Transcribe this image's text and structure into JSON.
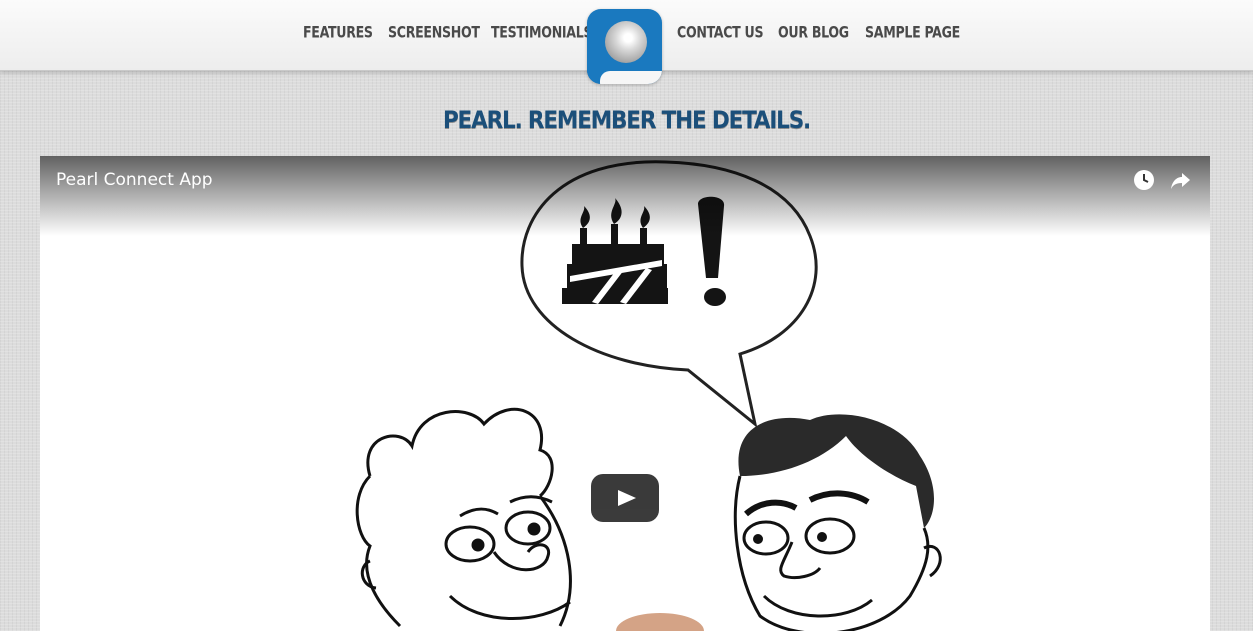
{
  "nav": {
    "items": [
      {
        "label": "FEATURES"
      },
      {
        "label": "SCREENSHOT"
      },
      {
        "label": "TESTIMONIALS"
      },
      {
        "label": "CONTACT US"
      },
      {
        "label": "OUR BLOG"
      },
      {
        "label": "SAMPLE PAGE"
      }
    ],
    "logo_icon": "pearl-p-logo"
  },
  "headline": "PEARL. REMEMBER THE DETAILS.",
  "video": {
    "title": "Pearl Connect App",
    "icons": [
      "watch-later-icon",
      "share-icon",
      "play-icon"
    ]
  },
  "colors": {
    "headline": "#1b4f7a",
    "logo_blue": "#1a79bf",
    "nav_text": "#4a4a4a"
  }
}
